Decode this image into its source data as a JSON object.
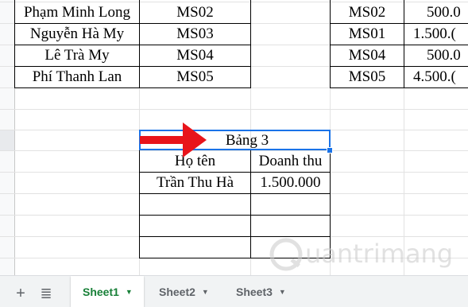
{
  "table1": {
    "rows": [
      {
        "name": "Phạm Minh Long",
        "code": "MS02"
      },
      {
        "name": "Nguyễn Hà My",
        "code": "MS03"
      },
      {
        "name": "Lê Trà My",
        "code": "MS04"
      },
      {
        "name": "Phí Thanh Lan",
        "code": "MS05"
      }
    ]
  },
  "table2": {
    "rows": [
      {
        "code": "MS02",
        "amount": "500.0"
      },
      {
        "code": "MS01",
        "amount": "1.500.("
      },
      {
        "code": "MS04",
        "amount": "500.0"
      },
      {
        "code": "MS05",
        "amount": "4.500.("
      }
    ]
  },
  "table3": {
    "title": "Bảng 3",
    "headers": [
      "Họ tên",
      "Doanh thu"
    ],
    "rows": [
      {
        "name": "Trần Thu Hà",
        "revenue": "1.500.000"
      },
      {
        "name": "",
        "revenue": ""
      },
      {
        "name": "",
        "revenue": ""
      },
      {
        "name": "",
        "revenue": ""
      }
    ]
  },
  "sheet_tabs": {
    "add_icon": "plus-icon",
    "list_icon": "all-sheets-icon",
    "tabs": [
      {
        "label": "Sheet1",
        "active": true
      },
      {
        "label": "Sheet2",
        "active": false
      },
      {
        "label": "Sheet3",
        "active": false
      }
    ]
  },
  "watermark": {
    "text": "uantrimang"
  },
  "colors": {
    "accent": "#1a73e8",
    "arrow": "#e8141b",
    "active_tab": "#188038"
  }
}
